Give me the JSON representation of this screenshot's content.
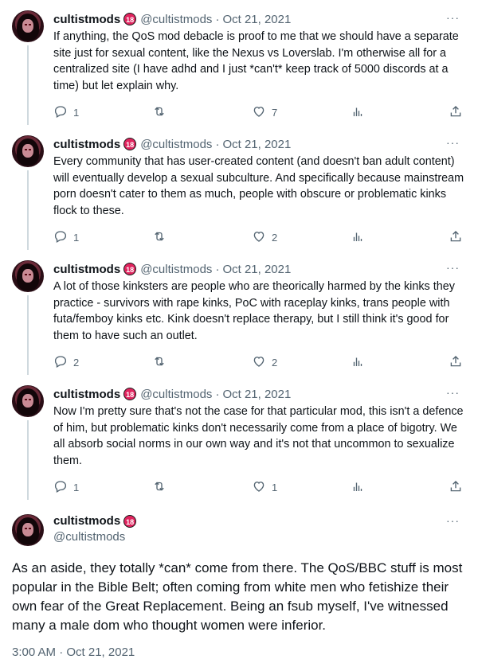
{
  "user": {
    "display_name": "cultistmods",
    "badge": "18",
    "handle": "@cultistmods"
  },
  "thread": [
    {
      "date": "Oct 21, 2021",
      "text": "If anything, the QoS mod debacle is proof to me that we should have a separate site just for sexual content, like the Nexus vs Loverslab. I'm otherwise all for a centralized site (I have adhd and I just *can't* keep track of 5000 discords at a time) but let explain why.",
      "replies": "1",
      "retweets": "",
      "likes": "7"
    },
    {
      "date": "Oct 21, 2021",
      "text": "Every community that has user-created content (and doesn't ban adult content) will eventually develop a sexual subculture. And specifically because mainstream porn doesn't cater to them as much, people with obscure or problematic kinks flock to these.",
      "replies": "1",
      "retweets": "",
      "likes": "2"
    },
    {
      "date": "Oct 21, 2021",
      "text": "A lot of those kinksters are people who are theorically harmed by the kinks they practice - survivors with rape kinks, PoC with raceplay kinks, trans people with futa/femboy kinks etc. Kink doesn't replace therapy, but I still think it's good for them to have such an outlet.",
      "replies": "2",
      "retweets": "",
      "likes": "2"
    },
    {
      "date": "Oct 21, 2021",
      "text": "Now I'm pretty sure that's not the case for that particular mod, this isn't a defence of him, but problematic kinks don't necessarily come from a place of bigotry. We all absorb social norms in our own way and it's not that uncommon to sexualize them.",
      "replies": "1",
      "retweets": "",
      "likes": "1"
    }
  ],
  "main_tweet": {
    "text": "As an aside, they totally *can* come from there. The QoS/BBC stuff is most popular in the Bible Belt; often coming from white men who fetishize their own fear of the Great Replacement. Being an fsub myself, I've witnessed many a male dom who thought women were inferior.",
    "timestamp": "3:00 AM · Oct 21, 2021"
  },
  "ui": {
    "dot": "·",
    "more": "···"
  },
  "icons": [
    "reply-icon",
    "retweet-icon",
    "like-icon",
    "views-icon",
    "share-icon",
    "more-icon"
  ]
}
